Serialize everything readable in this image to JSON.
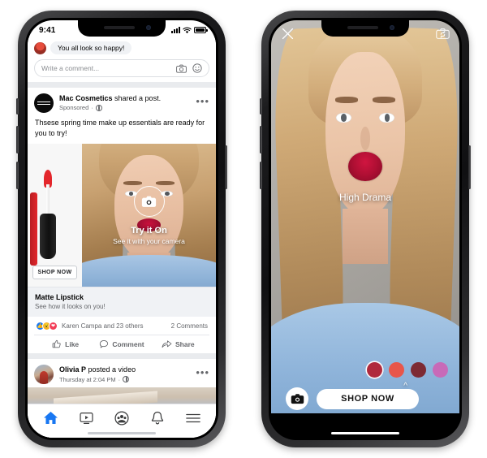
{
  "left_phone": {
    "status_bar": {
      "time": "9:41",
      "signal_icon": "signal-bars-icon",
      "wifi_icon": "wifi-icon",
      "battery_icon": "battery-icon"
    },
    "comment_preview": {
      "text": "You all look so happy!"
    },
    "composer": {
      "placeholder": "Write a comment...",
      "camera_icon": "camera-icon",
      "emoji_icon": "emoji-icon"
    },
    "sponsored_post": {
      "author": "Mac Cosmetics",
      "action": " shared a post.",
      "meta": "Sponsored",
      "privacy_icon": "globe-icon",
      "menu_icon": "more-options-icon",
      "body": "Thsese spring time make up essentials are ready for you to try!",
      "shop_button": "SHOP NOW",
      "tryon": {
        "title": "Try it On",
        "subtitle": "See it with your camera",
        "icon": "camera-icon"
      },
      "product": {
        "name": "Matte Lipstick",
        "subtitle": "See how it looks on you!"
      },
      "reactions": {
        "like_icon": "thumbs-up-reaction-icon",
        "wow_icon": "wow-reaction-icon",
        "love_icon": "heart-reaction-icon",
        "names": "Karen Campa and 23 others",
        "comments": "2 Comments"
      },
      "actions": [
        {
          "label": "Like",
          "icon": "thumbs-up-icon"
        },
        {
          "label": "Comment",
          "icon": "comment-bubble-icon"
        },
        {
          "label": "Share",
          "icon": "share-arrow-icon"
        }
      ]
    },
    "next_post": {
      "author": "Olivia P",
      "action": " posted a video",
      "meta": "Thursday at 2:04 PM",
      "privacy_icon": "globe-icon",
      "menu_icon": "more-options-icon"
    },
    "tab_bar": [
      {
        "name": "home",
        "icon": "home-icon",
        "active": true
      },
      {
        "name": "watch",
        "icon": "video-play-icon",
        "active": false
      },
      {
        "name": "groups",
        "icon": "groups-icon",
        "active": false
      },
      {
        "name": "notifications",
        "icon": "bell-icon",
        "active": false
      },
      {
        "name": "menu",
        "icon": "hamburger-menu-icon",
        "active": false
      }
    ],
    "accent_color": "#1877f2"
  },
  "right_phone": {
    "close_icon": "close-x-icon",
    "flip_camera_icon": "flip-camera-icon",
    "shade_label": "High Drama",
    "swatches": [
      {
        "name": "high-drama",
        "color": "#b02a3d",
        "selected": true
      },
      {
        "name": "coral",
        "color": "#e8564a",
        "selected": false
      },
      {
        "name": "deep-maroon",
        "color": "#7d2a33",
        "selected": false
      },
      {
        "name": "orchid-pink",
        "color": "#c86ab8",
        "selected": false
      }
    ],
    "expand_icon": "chevron-up-icon",
    "camera_button_icon": "camera-icon",
    "shop_button": "SHOP NOW"
  }
}
